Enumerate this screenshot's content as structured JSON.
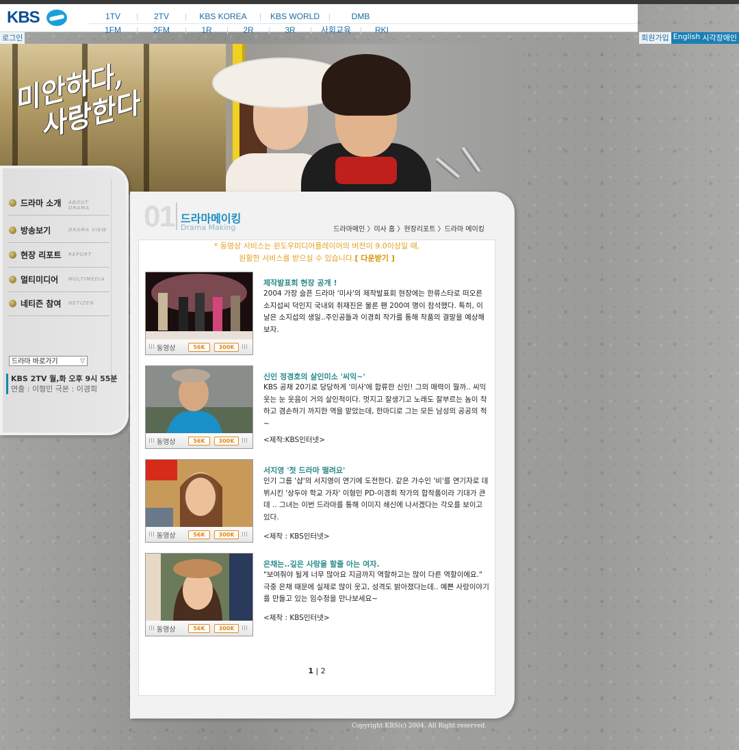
{
  "brand": {
    "logo": "KBS"
  },
  "nav": {
    "row1": [
      "1TV",
      "2TV",
      "KBS KOREA",
      "KBS WORLD",
      "DMB"
    ],
    "row2": [
      "1FM",
      "2FM",
      "1R",
      "2R",
      "3R",
      "사회교육",
      "RKI"
    ]
  },
  "util": {
    "login": "로그인",
    "join": "회원가입",
    "english": "English",
    "accessibility": "시각장애인"
  },
  "hero": {
    "title_line1": "미안하다,",
    "title_line2": "사랑한다"
  },
  "sidebar": {
    "menu": [
      {
        "label": "드라마 소개",
        "sub": "ABOUT DRAMA"
      },
      {
        "label": "방송보기",
        "sub": "DRAMA VIEW"
      },
      {
        "label": "현장 리포트",
        "sub": "REPORT"
      },
      {
        "label": "멀티미디어",
        "sub": "MULTIMEDIA"
      },
      {
        "label": "네티즌 참여",
        "sub": "NETIZEN"
      }
    ],
    "select_value": "드라마 바로가기",
    "airtime": "KBS 2TV 월,화 오후 9시 55분",
    "staff": "연출 : 이형민  극본 : 이경희"
  },
  "section": {
    "number": "01",
    "title": "드라마메이킹",
    "title_en": "Drama Making",
    "breadcrumb": "드라마메인 〉미사 홈 〉현장리포트 〉드라마 메이킹"
  },
  "notice": {
    "line1": "* 동영상 서비스는 윈도우미디어플레이어의 버전이 9.0이상일 때,",
    "line2": "원활한 서비스를 받으실 수 있습니다.",
    "download": "[ 다운받기 ]"
  },
  "video_bar": {
    "label": "동영상",
    "btn_low": "56K",
    "btn_high": "300K"
  },
  "items": [
    {
      "title": "제작발표회 현장 공개 !",
      "body": "2004 가장 슬픈 드라마 '미사'의 제작발표회 현장에는 한류스타로 떠오른 소지섭씨 덕인지 국내외 취재진은 물론 팬 200여 명이 참석했다. 특히, 이날은 소지섭의 생일..주인공들과 이경희 작가를 통해 작품의 결말을 예상해 보자.",
      "note": ""
    },
    {
      "title": "신인 정경호의 살인미소 '씨익~'",
      "body": "KBS 공채 20기로 당당하게 '미사'에 합류한 신인! 그의 매력이 뭘까.. 씨익 웃는 눈 웃음이 거의 살인적이다. 멋지고 잘생기고 노래도 잘부르는 놈이 착하고 겸손하기 까지한 역을 맡았는데, 한마디로 그는 모든 남성의 공공의 적 ~",
      "note": "<제작:KBS인터넷>"
    },
    {
      "title": "서지영 '첫 드라마 떨려요'",
      "body": "인기 그룹 '샵'의 서지영이 연기에 도전한다. 같은 가수인 '비'를 연기자로 데뷔시킨 '상두야 학교 가자' 이형민 PD-이경희 작가의 합작품이라 기대가 큰데 .. 그녀는 이번 드라마를 통해 이미지 쇄신에 나서겠다는 각오를 보이고 있다.",
      "note": "<제작 : KBS인터넷>"
    },
    {
      "title": "은채는..깊은 사랑을 할줄 아는 여자.",
      "body": "\"보여줘야 될게 너무 많아요 지금까지 역할하고는 많이 다른 역할이에요.\" 극중 은채 때문에 실제로 많이 웃고, 성격도 밝아졌다는데.. 예쁜 사랑이야기를 만들고 있는 임수정을 만나보세요~",
      "note": "<제작 : KBS인터넷>"
    }
  ],
  "pager": {
    "current": "1",
    "sep": "|",
    "next": "2"
  },
  "footer": {
    "copyright": "Copyright KBS(c) 2004. All Right reserved."
  },
  "colors": {
    "accent": "#1a8ec0",
    "notice": "#e3a020",
    "nav_link": "#1a6aa3",
    "item_title": "#2a8a8a"
  }
}
